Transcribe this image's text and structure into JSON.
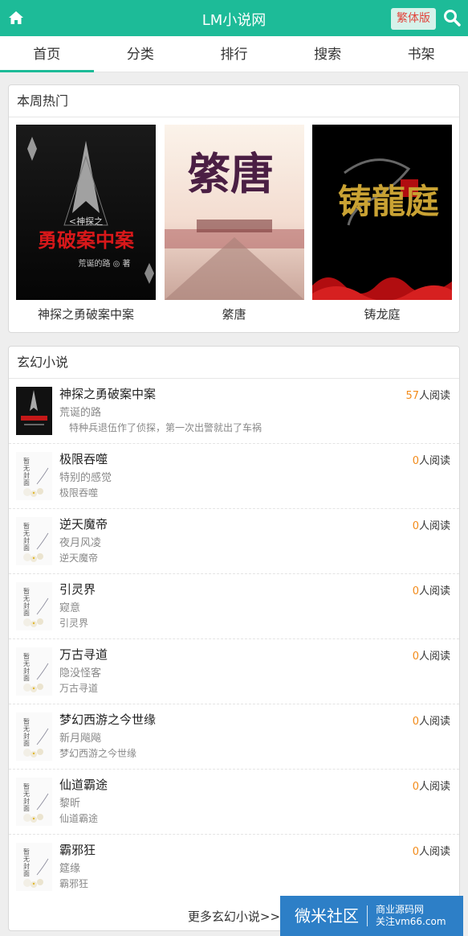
{
  "header": {
    "title": "LM小说网",
    "trad_label": "繁体版",
    "icons": [
      "home-icon",
      "search-icon"
    ],
    "accent_color": "#1dbb98"
  },
  "tabs": [
    {
      "label": "首页",
      "active": true
    },
    {
      "label": "分类"
    },
    {
      "label": "排行"
    },
    {
      "label": "搜索"
    },
    {
      "label": "书架"
    }
  ],
  "hot": {
    "heading": "本周热门",
    "items": [
      {
        "name": "神探之勇破案中案",
        "cover_title": "勇破案中案",
        "cover_subtitle": "<神探之",
        "cover_author": "荒诞的路 ◎ 著"
      },
      {
        "name": "綮唐",
        "cover_title": "綮唐"
      },
      {
        "name": "铸龙庭",
        "cover_title": "铸龍庭"
      }
    ]
  },
  "fantasy": {
    "heading": "玄幻小说",
    "read_suffix": "人阅读",
    "books": [
      {
        "name": "神探之勇破案中案",
        "author": "荒诞的路",
        "desc": "　特种兵退伍作了侦探，第一次出警就出了车祸",
        "reads": "57",
        "cover": "dark"
      },
      {
        "name": "极限吞噬",
        "author": "特别的感觉",
        "desc": "极限吞噬",
        "reads": "0",
        "cover": "blank"
      },
      {
        "name": "逆天魔帝",
        "author": "夜月风凌",
        "desc": "逆天魔帝",
        "reads": "0",
        "cover": "blank"
      },
      {
        "name": "引灵界",
        "author": "窥意",
        "desc": "引灵界",
        "reads": "0",
        "cover": "blank"
      },
      {
        "name": "万古寻道",
        "author": "隐没怪客",
        "desc": "万古寻道",
        "reads": "0",
        "cover": "blank"
      },
      {
        "name": "梦幻西游之今世缘",
        "author": "新月飚飚",
        "desc": "梦幻西游之今世缘",
        "reads": "0",
        "cover": "blank"
      },
      {
        "name": "仙道霸途",
        "author": "黎昕",
        "desc": "仙道霸途",
        "reads": "0",
        "cover": "blank"
      },
      {
        "name": "霸邪狂",
        "author": "筵缘",
        "desc": "霸邪狂",
        "reads": "0",
        "cover": "blank"
      }
    ],
    "more": "更多玄幻小说>>"
  },
  "blank_cover_text": "暂无封面",
  "watermark": {
    "big": "微米社区",
    "line1": "商业源码网",
    "line2": "关注vm66.com"
  }
}
